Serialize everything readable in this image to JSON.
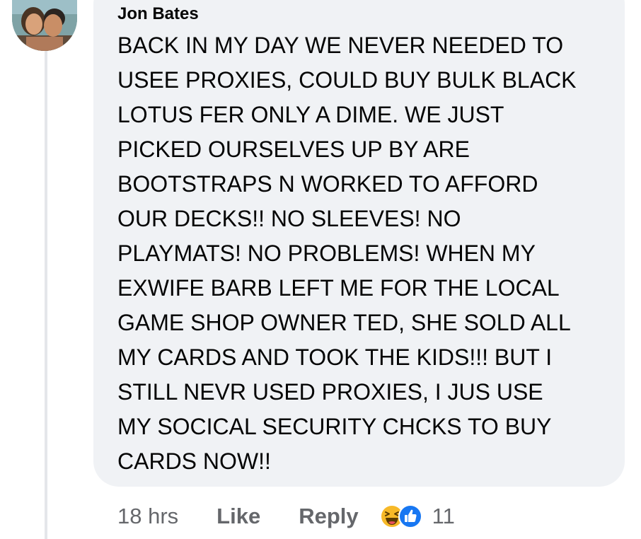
{
  "comment": {
    "author": "Jon Bates",
    "avatar_icon": "profile-photo-couple",
    "lines": [
      "BACK IN MY DAY WE NEVER NEEDED TO",
      "USEE PROXIES, COULD BUY BULK BLACK",
      "LOTUS FER ONLY A DIME. WE JUST",
      "PICKED OURSELVES UP BY ARE",
      "BOOTSTRAPS N WORKED TO AFFORD",
      "OUR DECKS!! NO SLEEVES! NO",
      "PLAYMATS! NO PROBLEMS! WHEN MY",
      "EXWIFE BARB LEFT ME FOR THE LOCAL",
      "GAME SHOP OWNER TED, SHE SOLD ALL",
      "MY CARDS AND TOOK THE KIDS!!! BUT I",
      "STILL NEVR USED PROXIES, I JUS USE",
      "MY SOCICAL SECURITY CHCKS TO BUY",
      "CARDS NOW!!"
    ],
    "timestamp": "18 hrs",
    "like_label": "Like",
    "reply_label": "Reply",
    "reactions": {
      "icons": [
        "laugh-reaction-icon",
        "like-reaction-icon"
      ],
      "count": "11"
    }
  },
  "colors": {
    "bubble_background": "#f0f2f5",
    "text": "#050505",
    "secondary_text": "#65676b",
    "like_blue": "#1877f2",
    "laugh_yellow": "#f7b928"
  }
}
